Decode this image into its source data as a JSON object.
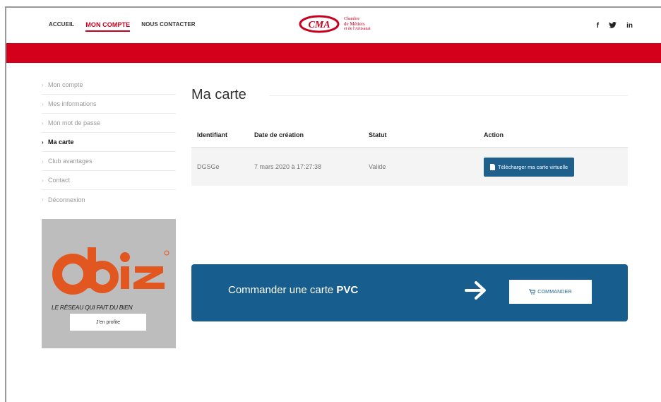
{
  "nav": {
    "items": [
      {
        "label": "ACCUEIL",
        "active": false
      },
      {
        "label": "MON COMPTE",
        "active": true
      },
      {
        "label": "NOUS CONTACTER",
        "active": false
      }
    ]
  },
  "logo": {
    "line1": "Chambre",
    "line2": "de Métiers",
    "line3": "et de l'Artisanat"
  },
  "social": {
    "facebook": "f",
    "twitter": "🐦",
    "linkedin": "in"
  },
  "sidebar": {
    "items": [
      {
        "label": "Mon compte"
      },
      {
        "label": "Mes informations"
      },
      {
        "label": "Mon mot de passe"
      },
      {
        "label": "Ma carte"
      },
      {
        "label": "Club avantages"
      },
      {
        "label": "Contact"
      },
      {
        "label": "Déconnexion"
      }
    ],
    "active_index": 3
  },
  "ad": {
    "brand": "obiz",
    "tagline": "LE RÉSEAU QUI FAIT DU BIEN",
    "button": "J'en profite"
  },
  "main": {
    "title": "Ma carte",
    "table": {
      "headers": [
        "Identifiant",
        "Date de création",
        "Statut",
        "Action"
      ],
      "row": {
        "id": "DGSGe",
        "date": "7 mars 2020 à 17:27:38",
        "status": "Valide",
        "action": "Télécharger ma carte virtuelle"
      }
    },
    "banner": {
      "text_prefix": "Commander une carte",
      "text_strong": "PVC",
      "button": "COMMANDER"
    }
  },
  "colors": {
    "brand_red": "#d4001b",
    "primary_blue": "#175d8d",
    "obiz_orange": "#e2571f"
  }
}
